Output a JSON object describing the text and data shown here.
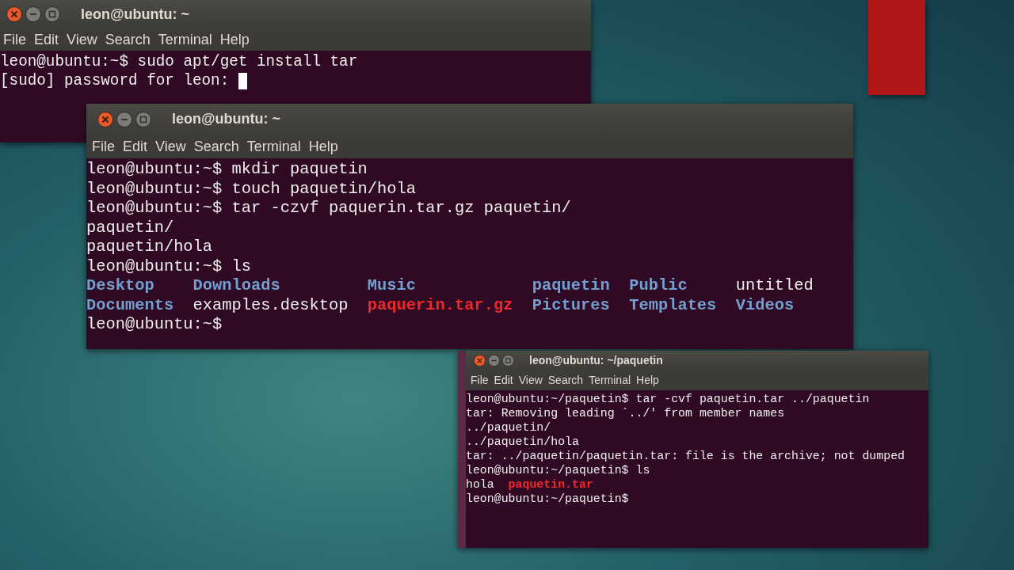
{
  "windows": [
    {
      "title": "leon@ubuntu: ~",
      "menu": [
        "File",
        "Edit",
        "View",
        "Search",
        "Terminal",
        "Help"
      ],
      "lines": [
        {
          "kind": "plain",
          "cursor": false,
          "cells": [
            {
              "kind": "text",
              "text": "leon@ubuntu:~$ sudo apt/get install tar"
            }
          ]
        },
        {
          "kind": "plain",
          "cursor": true,
          "cells": [
            {
              "kind": "text",
              "text": "[sudo] password for leon: "
            }
          ]
        }
      ]
    },
    {
      "title": "leon@ubuntu: ~",
      "menu": [
        "File",
        "Edit",
        "View",
        "Search",
        "Terminal",
        "Help"
      ],
      "lines": [
        {
          "kind": "plain",
          "cursor": false,
          "cells": [
            {
              "kind": "text",
              "text": "leon@ubuntu:~$ mkdir paquetin"
            }
          ]
        },
        {
          "kind": "plain",
          "cursor": false,
          "cells": [
            {
              "kind": "text",
              "text": "leon@ubuntu:~$ touch paquetin/hola"
            }
          ]
        },
        {
          "kind": "plain",
          "cursor": false,
          "cells": [
            {
              "kind": "text",
              "text": "leon@ubuntu:~$ tar -czvf paquerin.tar.gz paquetin/"
            }
          ]
        },
        {
          "kind": "plain",
          "cursor": false,
          "cells": [
            {
              "kind": "text",
              "text": "paquetin/"
            }
          ]
        },
        {
          "kind": "plain",
          "cursor": false,
          "cells": [
            {
              "kind": "text",
              "text": "paquetin/hola"
            }
          ]
        },
        {
          "kind": "plain",
          "cursor": false,
          "cells": [
            {
              "kind": "text",
              "text": "leon@ubuntu:~$ ls"
            }
          ]
        },
        {
          "kind": "columns",
          "cursor": false,
          "cells": [
            {
              "kind": "dir",
              "text": "Desktop"
            },
            {
              "kind": "dir",
              "text": "Downloads"
            },
            {
              "kind": "dir",
              "text": "Music"
            },
            {
              "kind": "dir",
              "text": "paquetin"
            },
            {
              "kind": "dir",
              "text": "Public"
            },
            {
              "kind": "text",
              "text": "untitled"
            }
          ]
        },
        {
          "kind": "columns",
          "cursor": false,
          "cells": [
            {
              "kind": "dir",
              "text": "Documents"
            },
            {
              "kind": "text",
              "text": "examples.desktop"
            },
            {
              "kind": "archive",
              "text": "paquerin.tar.gz"
            },
            {
              "kind": "dir",
              "text": "Pictures"
            },
            {
              "kind": "dir",
              "text": "Templates"
            },
            {
              "kind": "dir",
              "text": "Videos"
            }
          ]
        },
        {
          "kind": "plain",
          "cursor": false,
          "cells": [
            {
              "kind": "text",
              "text": "leon@ubuntu:~$"
            }
          ]
        }
      ]
    },
    {
      "title": "leon@ubuntu: ~/paquetin",
      "menu": [
        "File",
        "Edit",
        "View",
        "Search",
        "Terminal",
        "Help"
      ],
      "lines": [
        {
          "kind": "plain",
          "cursor": false,
          "cells": [
            {
              "kind": "text",
              "text": "leon@ubuntu:~/paquetin$ tar -cvf paquetin.tar ../paquetin"
            }
          ]
        },
        {
          "kind": "plain",
          "cursor": false,
          "cells": [
            {
              "kind": "text",
              "text": "tar: Removing leading `../' from member names"
            }
          ]
        },
        {
          "kind": "plain",
          "cursor": false,
          "cells": [
            {
              "kind": "text",
              "text": "../paquetin/"
            }
          ]
        },
        {
          "kind": "plain",
          "cursor": false,
          "cells": [
            {
              "kind": "text",
              "text": "../paquetin/hola"
            }
          ]
        },
        {
          "kind": "plain",
          "cursor": false,
          "cells": [
            {
              "kind": "text",
              "text": "tar: ../paquetin/paquetin.tar: file is the archive; not dumped"
            }
          ]
        },
        {
          "kind": "plain",
          "cursor": false,
          "cells": [
            {
              "kind": "text",
              "text": "leon@ubuntu:~/paquetin$ ls"
            }
          ]
        },
        {
          "kind": "columns",
          "cursor": false,
          "cells": [
            {
              "kind": "text",
              "text": "hola"
            },
            {
              "kind": "archive",
              "text": "paquetin.tar"
            }
          ]
        },
        {
          "kind": "plain",
          "cursor": false,
          "cells": [
            {
              "kind": "text",
              "text": "leon@ubuntu:~/paquetin$"
            }
          ]
        }
      ]
    }
  ]
}
